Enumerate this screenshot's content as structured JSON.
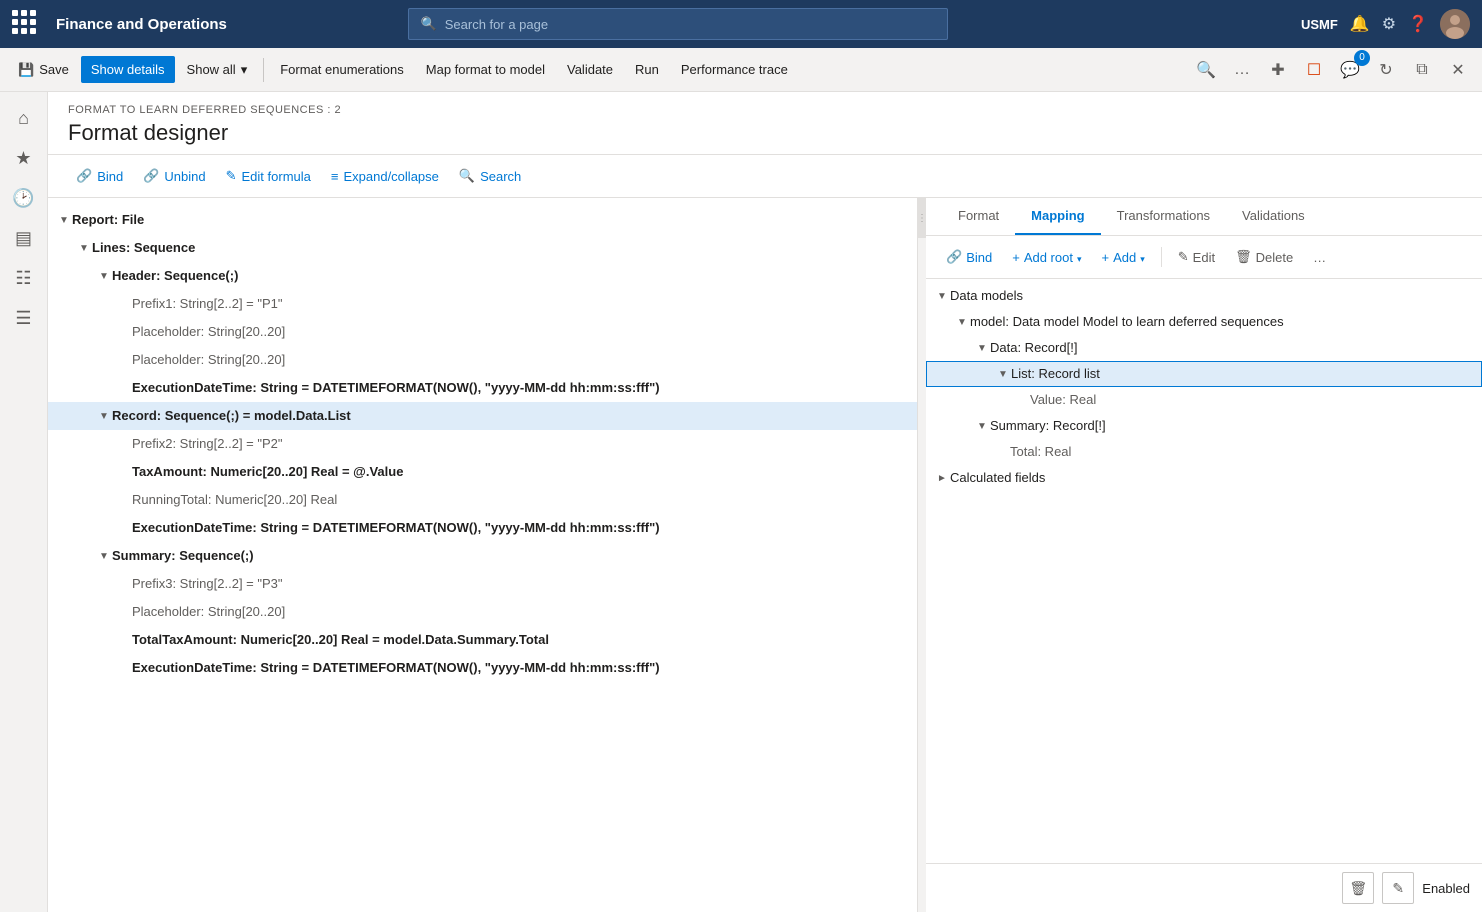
{
  "app": {
    "title": "Finance and Operations",
    "search_placeholder": "Search for a page",
    "user_code": "USMF"
  },
  "toolbar": {
    "save_label": "Save",
    "show_details_label": "Show details",
    "show_all_label": "Show all",
    "format_enumerations_label": "Format enumerations",
    "map_format_to_model_label": "Map format to model",
    "validate_label": "Validate",
    "run_label": "Run",
    "performance_trace_label": "Performance trace"
  },
  "designer": {
    "bind_label": "Bind",
    "unbind_label": "Unbind",
    "edit_formula_label": "Edit formula",
    "expand_collapse_label": "Expand/collapse",
    "search_label": "Search"
  },
  "breadcrumb": "FORMAT TO LEARN DEFERRED SEQUENCES : 2",
  "page_title": "Format designer",
  "tree": {
    "items": [
      {
        "level": 0,
        "toggle": "▾",
        "label": "Report: File",
        "type": "bold dark",
        "indent": 0
      },
      {
        "level": 1,
        "toggle": "▾",
        "label": "Lines: Sequence",
        "type": "bold dark",
        "indent": 1
      },
      {
        "level": 2,
        "toggle": "▾",
        "label": "Header: Sequence(;)",
        "type": "bold dark",
        "indent": 2
      },
      {
        "level": 3,
        "toggle": "",
        "label": "Prefix1: String[2..2] = \"P1\"",
        "type": "gray",
        "indent": 3
      },
      {
        "level": 3,
        "toggle": "",
        "label": "Placeholder: String[20..20]",
        "type": "gray",
        "indent": 3
      },
      {
        "level": 3,
        "toggle": "",
        "label": "Placeholder: String[20..20]",
        "type": "gray",
        "indent": 3
      },
      {
        "level": 3,
        "toggle": "",
        "label": "ExecutionDateTime: String = DATETIMEFORMAT(NOW(), \"yyyy-MM-dd hh:mm:ss:fff\")",
        "type": "bold dark",
        "indent": 3
      },
      {
        "level": 2,
        "toggle": "▾",
        "label": "Record: Sequence(;) = model.Data.List",
        "type": "bold dark",
        "indent": 2,
        "selected": true
      },
      {
        "level": 3,
        "toggle": "",
        "label": "Prefix2: String[2..2] = \"P2\"",
        "type": "gray",
        "indent": 3
      },
      {
        "level": 3,
        "toggle": "",
        "label": "TaxAmount: Numeric[20..20] Real = @.Value",
        "type": "bold dark",
        "indent": 3
      },
      {
        "level": 3,
        "toggle": "",
        "label": "RunningTotal: Numeric[20..20] Real",
        "type": "gray",
        "indent": 3
      },
      {
        "level": 3,
        "toggle": "",
        "label": "ExecutionDateTime: String = DATETIMEFORMAT(NOW(), \"yyyy-MM-dd hh:mm:ss:fff\")",
        "type": "bold dark",
        "indent": 3
      },
      {
        "level": 2,
        "toggle": "▾",
        "label": "Summary: Sequence(;)",
        "type": "bold dark",
        "indent": 2
      },
      {
        "level": 3,
        "toggle": "",
        "label": "Prefix3: String[2..2] = \"P3\"",
        "type": "gray",
        "indent": 3
      },
      {
        "level": 3,
        "toggle": "",
        "label": "Placeholder: String[20..20]",
        "type": "gray",
        "indent": 3
      },
      {
        "level": 3,
        "toggle": "",
        "label": "TotalTaxAmount: Numeric[20..20] Real = model.Data.Summary.Total",
        "type": "bold dark",
        "indent": 3
      },
      {
        "level": 3,
        "toggle": "",
        "label": "ExecutionDateTime: String = DATETIMEFORMAT(NOW(), \"yyyy-MM-dd hh:mm:ss:fff\")",
        "type": "bold dark",
        "indent": 3
      }
    ]
  },
  "mapping": {
    "tabs": [
      {
        "label": "Format",
        "id": "format"
      },
      {
        "label": "Mapping",
        "id": "mapping",
        "active": true
      },
      {
        "label": "Transformations",
        "id": "transformations"
      },
      {
        "label": "Validations",
        "id": "validations"
      }
    ],
    "toolbar": {
      "bind_label": "Bind",
      "add_root_label": "Add root",
      "add_label": "Add",
      "edit_label": "Edit",
      "delete_label": "Delete"
    },
    "tree": [
      {
        "level": 0,
        "toggle": "▾",
        "label": "Data models",
        "indent": 0,
        "type": "dark"
      },
      {
        "level": 1,
        "toggle": "▾",
        "label": "model: Data model Model to learn deferred sequences",
        "indent": 1,
        "type": "dark"
      },
      {
        "level": 2,
        "toggle": "▾",
        "label": "Data: Record[!]",
        "indent": 2,
        "type": "dark"
      },
      {
        "level": 3,
        "toggle": "▾",
        "label": "List: Record list",
        "indent": 3,
        "type": "dark",
        "selected": true
      },
      {
        "level": 4,
        "toggle": "",
        "label": "Value: Real",
        "indent": 4,
        "type": "gray"
      },
      {
        "level": 2,
        "toggle": "▾",
        "label": "Summary: Record[!]",
        "indent": 2,
        "type": "dark"
      },
      {
        "level": 3,
        "toggle": "",
        "label": "Total: Real",
        "indent": 3,
        "type": "gray"
      },
      {
        "level": 0,
        "toggle": "▸",
        "label": "Calculated fields",
        "indent": 0,
        "type": "dark"
      }
    ],
    "footer": {
      "status": "Enabled"
    }
  }
}
